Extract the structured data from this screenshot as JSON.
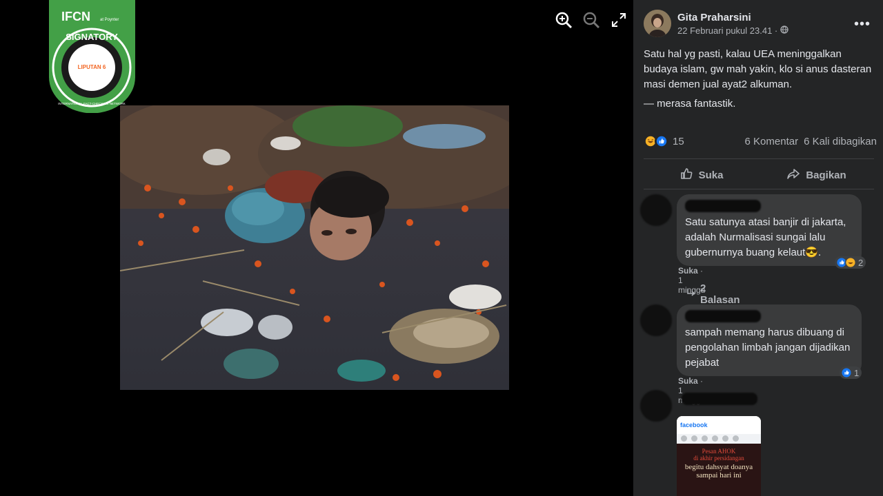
{
  "badge": {
    "ifcn": "IFCN",
    "poynter": "at Poynter",
    "signatory": "SIGNATORY",
    "ring": "INTERNATIONAL FACT-CHECKING NETWORK",
    "outlet": "LIPUTAN 6"
  },
  "viewer": {
    "zoom_in_icon": "zoom-in-icon",
    "zoom_out_icon": "zoom-out-icon",
    "fullscreen_icon": "expand-icon"
  },
  "post": {
    "author": "Gita Praharsini",
    "time": "22 Februari pukul 23.41 ·",
    "text_line1": "Satu hal yg pasti, kalau UEA meninggalkan budaya islam, gw mah yakin, klo si anus dasteran masi demen jual ayat2 alkuman.",
    "text_line2": "— merasa fantastik.",
    "reaction_count": "15",
    "comments": "6 Komentar",
    "shares": "6 Kali dibagikan",
    "like_label": "Suka",
    "share_label": "Bagikan"
  },
  "comments": [
    {
      "text": "Satu satunya atasi banjir di jakarta, adalah Nurmalisasi sungai lalu gubernurnya buang kelaut😎.",
      "like": "Suka",
      "time": "· 1 minggu",
      "reaction_count": "2",
      "replies": "2 Balasan"
    },
    {
      "text": "sampah memang harus dibuang di pengolahan limbah jangan dijadikan pejabat",
      "like": "Suka",
      "time": "· 1 minggu",
      "reaction_count": "1"
    },
    {
      "image": {
        "app": "facebook",
        "line1": "Pesan AHOK",
        "line2": "di akhir persidangan",
        "line3": "begitu dahsyat doanya",
        "line4": "sampai hari ini"
      }
    }
  ],
  "colors": {
    "panel": "#242526",
    "bubble": "#3a3b3c",
    "badge_green": "#4caf50",
    "like_blue": "#1877f2"
  }
}
